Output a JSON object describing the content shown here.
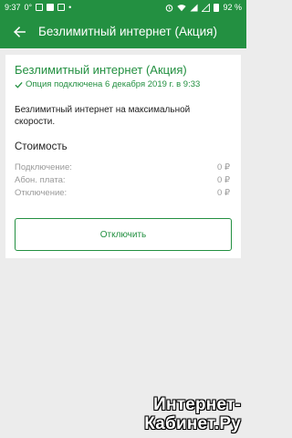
{
  "status_bar": {
    "time": "9:37",
    "extra": "0°",
    "battery_percent": "92 %",
    "battery_level": 0.92
  },
  "app_bar": {
    "title": "Безлимитный интернет (Акция)"
  },
  "option": {
    "title": "Безлимитный интернет (Акция)",
    "status": "Опция подключена 6 декабря 2019 г. в 9:33",
    "description": "Безлимитный интернет на максимальной скорости."
  },
  "cost": {
    "heading": "Стоимость",
    "rows": [
      {
        "label": "Подключение:",
        "value": "0 ₽"
      },
      {
        "label": "Абон. плата:",
        "value": "0 ₽"
      },
      {
        "label": "Отключение:",
        "value": "0 ₽"
      }
    ]
  },
  "actions": {
    "disconnect_label": "Отключить"
  },
  "watermark": {
    "line1": "Интернет-",
    "line2": "Кабинет.Ру"
  },
  "colors": {
    "brand": "#239041",
    "background": "#ececec",
    "muted_text": "#9a9a9a"
  }
}
